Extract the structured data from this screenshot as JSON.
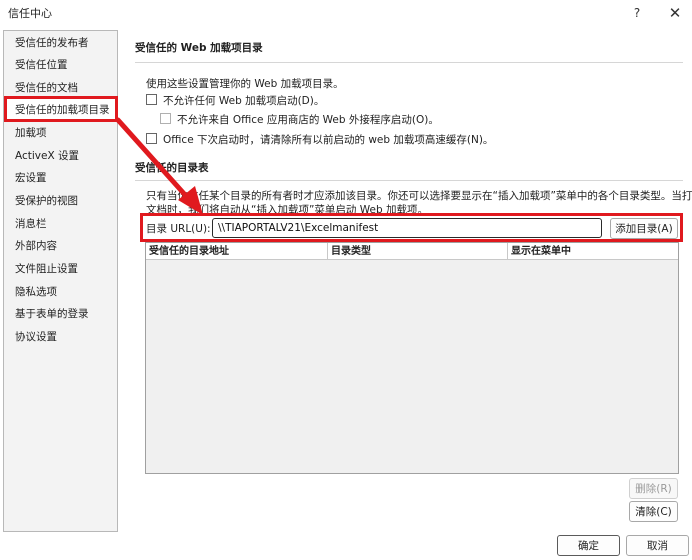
{
  "window": {
    "title": "信任中心",
    "help_glyph": "?",
    "close_glyph": "✕"
  },
  "sidebar": {
    "items": [
      {
        "label": "受信任的发布者"
      },
      {
        "label": "受信任位置"
      },
      {
        "label": "受信任的文档"
      },
      {
        "label": "受信任的加载项目录",
        "selected": true
      },
      {
        "label": "加载项"
      },
      {
        "label": "ActiveX 设置"
      },
      {
        "label": "宏设置"
      },
      {
        "label": "受保护的视图"
      },
      {
        "label": "消息栏"
      },
      {
        "label": "外部内容"
      },
      {
        "label": "文件阻止设置"
      },
      {
        "label": "隐私选项"
      },
      {
        "label": "基于表单的登录"
      },
      {
        "label": "协议设置"
      }
    ]
  },
  "main": {
    "section1_title": "受信任的 Web 加载项目录",
    "section1_desc": "使用这些设置管理你的 Web 加载项目录。",
    "option_disallow_web": "不允许任何 Web 加载项启动(D)。",
    "option_disallow_store": "不允许来自 Office 应用商店的 Web 外接程序启动(O)。",
    "option_clear_cache": "Office 下次启动时，请清除所有以前启动的 web 加载项高速缓存(N)。",
    "section2_title": "受信任的目录表",
    "section2_desc_line1": "只有当你信任某个目录的所有者时才应添加该目录。你还可以选择要显示在“插入加载项”菜单中的各个目录类型。当打开",
    "section2_desc_line2": "文档时，我们将自动从“插入加载项”菜单启动 Web 加载项。",
    "url_label": "目录 URL(U):",
    "url_value": "\\\\TIAPORTALV21\\Excelmanifest",
    "add_button": "添加目录(A)",
    "table_headers": [
      "受信任的目录地址",
      "目录类型",
      "显示在菜单中"
    ],
    "remove_button": "删除(R)",
    "clear_button": "清除(C)"
  },
  "footer": {
    "ok_button": "确定",
    "cancel_button": "取消"
  },
  "colors": {
    "highlight": "#e0191e"
  }
}
